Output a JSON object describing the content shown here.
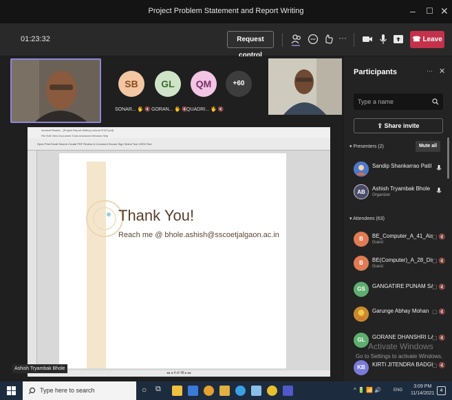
{
  "window": {
    "title": "Project Problem Statement and Report Writing"
  },
  "toolbar": {
    "timer": "01:23:32",
    "request_control": "Request control",
    "leave": "Leave"
  },
  "stage": {
    "avatars": [
      {
        "initials": "SB",
        "name": "SONAR...",
        "color": "#f3c7a3"
      },
      {
        "initials": "GL",
        "name": "GORAN...",
        "color": "#cfe3c8"
      },
      {
        "initials": "QM",
        "name": "QUADRI...",
        "color": "#f1c5e3"
      },
      {
        "initials": "+60",
        "name": "",
        "color": "#3d3d3d"
      }
    ],
    "presenter_name": "Ashish Tryambak Bhole"
  },
  "pdf": {
    "title_bar": "Acrobat Reader - [Project Report Writing Lecture BT&T.pdf]",
    "menu": "File  Edit  View  Document  Tools  Advanced  Window  Help",
    "toolbar": "Open  Print  Email  Search  Create PDF  Review & Comment  Secure  Sign    Select Tool    125%    Find",
    "status": "4 of 48",
    "slide_title": "Thank You!",
    "slide_contact": "Reach me @ bhole.ashish@sscoetjalgaon.ac.in"
  },
  "participants": {
    "title": "Participants",
    "search_placeholder": "Type a name",
    "share_invite": "Share invite",
    "presenters_label": "Presenters (2)",
    "mute_all": "Mute all",
    "attendees_label": "Attendees (63)",
    "presenters": [
      {
        "name": "Sandip Shankarrao Patil",
        "role": "",
        "initials": "",
        "color": "#6a8fd8"
      },
      {
        "name": "Ashish Tryambak Bhole",
        "role": "Organizer",
        "initials": "AB",
        "color": "#4a4a6a"
      }
    ],
    "attendees": [
      {
        "name": "BE_Computer_A_41_Aish...",
        "role": "Guest",
        "initials": "B",
        "color": "#e07b54"
      },
      {
        "name": "BE(Computer)_A_28_Dish...",
        "role": "Guest",
        "initials": "B",
        "color": "#e07b54"
      },
      {
        "name": "GANGATIRE PUNAM SAN...",
        "role": "",
        "initials": "GS",
        "color": "#5fae6f"
      },
      {
        "name": "Garunge Abhay Mohan",
        "role": "",
        "initials": "",
        "color": "#d9a441"
      },
      {
        "name": "GORANE DHANSHRI LAX...",
        "role": "",
        "initials": "GL",
        "color": "#5fae6f"
      },
      {
        "name": "KIRTI JITENDRA BADGUJAR",
        "role": "",
        "initials": "KB",
        "color": "#7a7ad8"
      }
    ],
    "watermark_line1": "Activate Windows",
    "watermark_line2": "Go to Settings to activate Windows."
  },
  "taskbar": {
    "search_placeholder": "Type here to search",
    "lang": "ENG",
    "time": "3:09 PM",
    "date": "11/14/2021"
  }
}
